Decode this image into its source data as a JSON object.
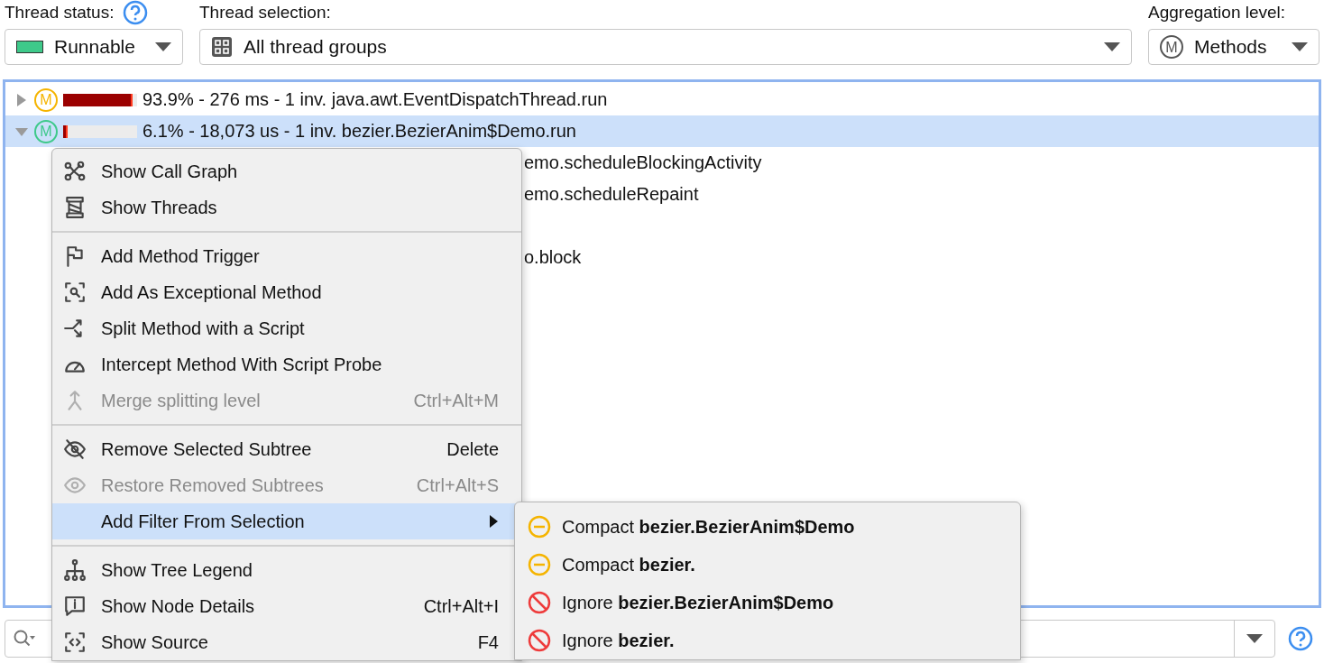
{
  "filters": [
    {
      "kind": "status",
      "label": "Thread status:",
      "value": "Runnable",
      "color": "#3ec98a"
    },
    {
      "kind": "selection",
      "label": "Thread selection:",
      "value": "All thread groups"
    },
    {
      "kind": "aggregation",
      "label": "Aggregation level:",
      "value": "Methods",
      "badge": "M"
    }
  ],
  "tree": [
    {
      "badge": "M",
      "color": "#f5b400",
      "level": 0.939,
      "text": "93.9% - 276 ms - 1 inv. java.awt.EventDispatchThread.run",
      "expanded": false,
      "selected": false
    },
    {
      "badge": "M",
      "color": "#3ec98a",
      "level": 0.061,
      "text": "6.1% - 18,073 us - 1 inv. bezier.BezierAnim$Demo.run",
      "expanded": true,
      "selected": true,
      "children": [
        {
          "text": "emo.scheduleBlockingActivity"
        },
        {
          "text": "emo.scheduleRepaint"
        },
        {
          "text": "o.block"
        }
      ]
    }
  ],
  "context_menu": [
    {
      "kind": "item",
      "label": "Show Call Graph",
      "disabled": false,
      "selected": false
    },
    {
      "kind": "item",
      "label": "Show Threads",
      "disabled": false,
      "selected": false
    },
    {
      "kind": "separator"
    },
    {
      "kind": "item",
      "label": "Add Method Trigger",
      "disabled": false,
      "selected": false
    },
    {
      "kind": "item",
      "label": "Add As Exceptional Method",
      "disabled": false,
      "selected": false
    },
    {
      "kind": "item",
      "label": "Split Method with a Script",
      "disabled": false,
      "selected": false
    },
    {
      "kind": "item",
      "label": "Intercept Method With Script Probe",
      "disabled": false,
      "selected": false
    },
    {
      "kind": "item",
      "label": "Merge splitting level",
      "shortcut": "Ctrl+Alt+M",
      "disabled": true,
      "selected": false
    },
    {
      "kind": "separator"
    },
    {
      "kind": "item",
      "label": "Remove Selected Subtree",
      "shortcut": "Delete",
      "disabled": false,
      "selected": false
    },
    {
      "kind": "item",
      "label": "Restore Removed Subtrees",
      "shortcut": "Ctrl+Alt+S",
      "disabled": true,
      "selected": false
    },
    {
      "kind": "item",
      "label": "Add Filter From Selection",
      "disabled": false,
      "selected": true,
      "submenu": true
    },
    {
      "kind": "separator"
    },
    {
      "kind": "item",
      "label": "Show Tree Legend",
      "disabled": false,
      "selected": false
    },
    {
      "kind": "item",
      "label": "Show Node Details",
      "shortcut": "Ctrl+Alt+I",
      "disabled": false,
      "selected": false
    },
    {
      "kind": "item",
      "label": "Show Source",
      "shortcut": "F4",
      "disabled": false,
      "selected": false
    }
  ],
  "submenu": [
    {
      "kind": "compact",
      "label": "Compact **bezier.BezierAnim$Demo**"
    },
    {
      "kind": "compact",
      "label": "Compact **bezier.**"
    },
    {
      "kind": "ignore",
      "label": "Ignore **bezier.BezierAnim$Demo**"
    },
    {
      "kind": "ignore",
      "label": "Ignore **bezier.**"
    }
  ]
}
